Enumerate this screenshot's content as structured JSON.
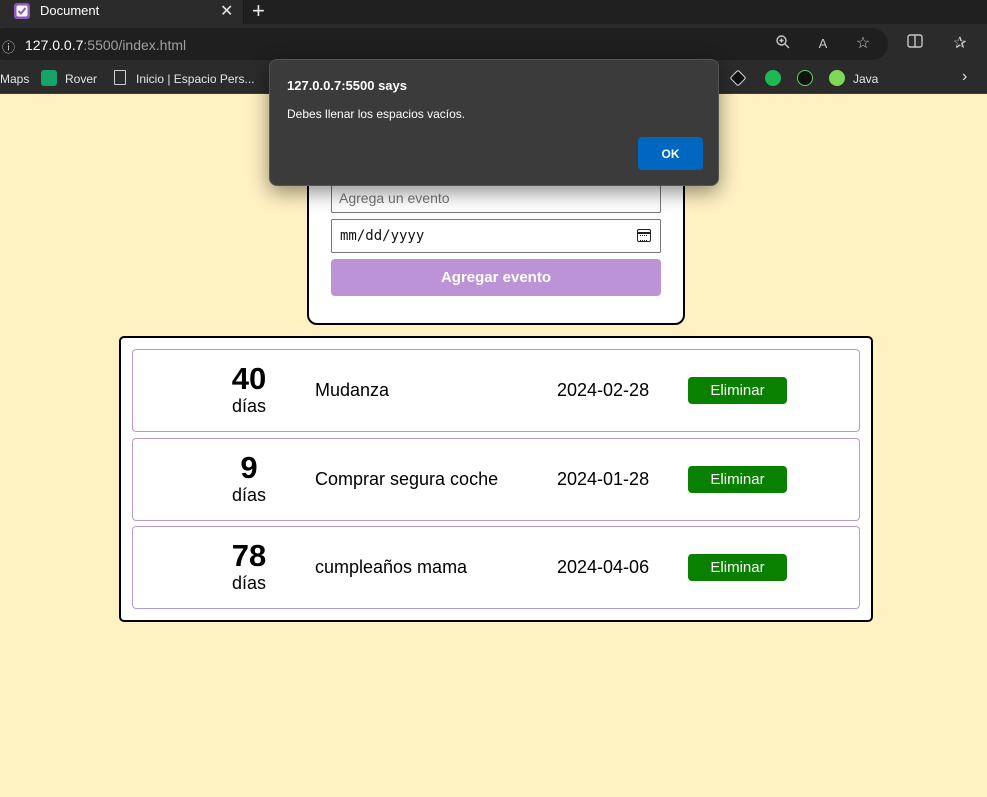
{
  "browser": {
    "tab_title": "Document",
    "tab_close": "✕",
    "new_tab": "+",
    "url_host": "127.0.0.7",
    "url_rest": ":5500/index.html",
    "bookmarks": [
      "Maps",
      "Rover",
      "Inicio | Espacio Pers...",
      "Java"
    ],
    "more_bookmarks": "›"
  },
  "form": {
    "event_placeholder": "Agrega un evento",
    "date_placeholder": "mm/dd/yyyy",
    "add_label": "Agregar evento"
  },
  "events": [
    {
      "days": "40",
      "days_label": "días",
      "name": "Mudanza",
      "date": "2024-02-28",
      "delete_label": "Eliminar"
    },
    {
      "days": "9",
      "days_label": "días",
      "name": "Comprar segura coche",
      "date": "2024-01-28",
      "delete_label": "Eliminar"
    },
    {
      "days": "78",
      "days_label": "días",
      "name": "cumpleaños mama",
      "date": "2024-04-06",
      "delete_label": "Eliminar"
    }
  ],
  "dialog": {
    "title": "127.0.0.7:5500 says",
    "message": "Debes llenar los espacios vacíos.",
    "ok_label": "OK"
  },
  "colors": {
    "page_bg": "#fff1c2",
    "add_button": "#bb93d6",
    "delete_button": "#0a8000",
    "ok_button": "#0067c0"
  }
}
